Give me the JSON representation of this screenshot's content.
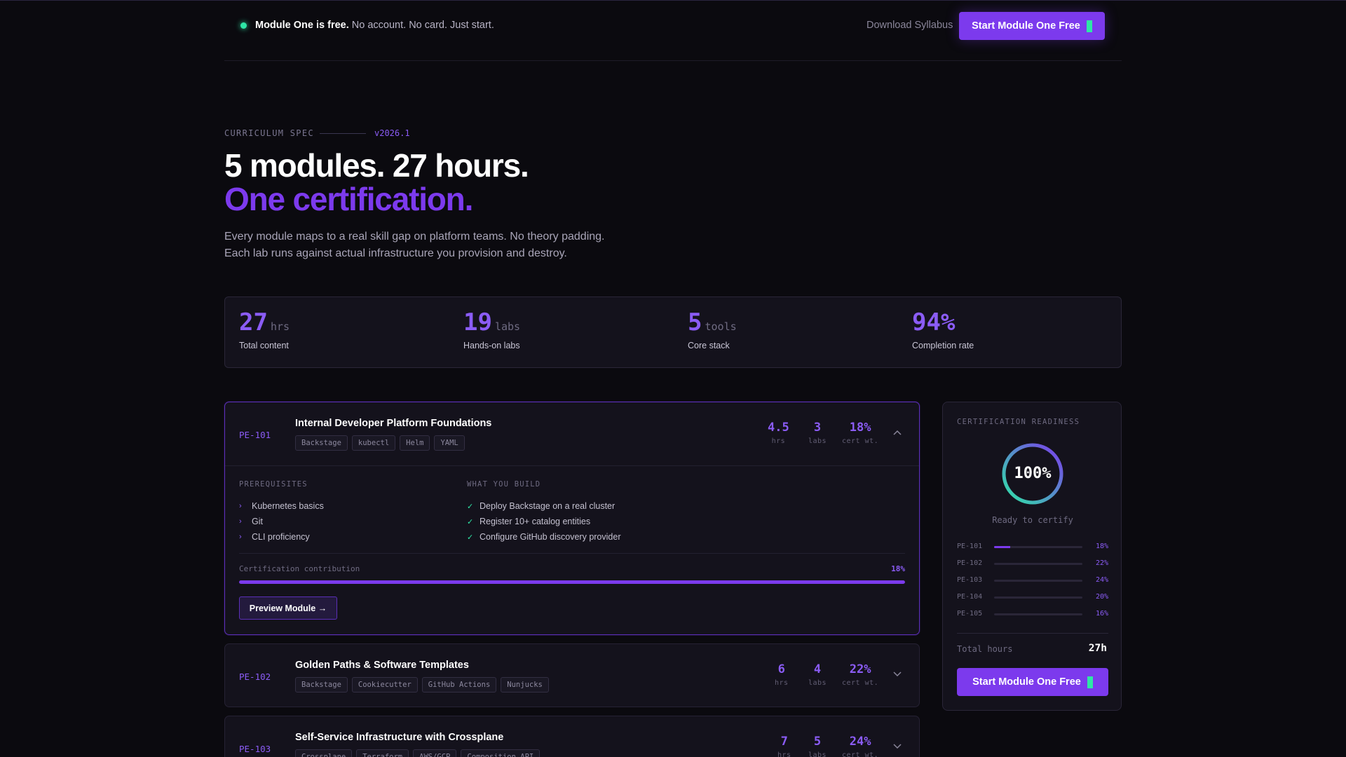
{
  "topbar": {
    "announce_bold": "Module One is free.",
    "announce_rest": "No account. No card. Just start.",
    "download_label": "Download Syllabus",
    "cta_label": "Start Module One Free"
  },
  "hero": {
    "eyebrow": "CURRICULUM SPEC",
    "version": "v2026.1",
    "title_line1": "5 modules. 27 hours.",
    "title_line2": "One certification.",
    "desc_line1": "Every module maps to a real skill gap on platform teams. No theory padding.",
    "desc_line2": "Each lab runs against actual infrastructure you provision and destroy."
  },
  "stats": [
    {
      "num": "27",
      "unit": "hrs",
      "label": "Total content"
    },
    {
      "num": "19",
      "unit": "labs",
      "label": "Hands-on labs"
    },
    {
      "num": "5",
      "unit": "tools",
      "label": "Core stack"
    },
    {
      "num": "94%",
      "unit": "",
      "label": "Completion rate"
    }
  ],
  "modules": [
    {
      "code": "PE-101",
      "title": "Internal Developer Platform Foundations",
      "tags": [
        "Backstage",
        "kubectl",
        "Helm",
        "YAML"
      ],
      "hrs": "4.5",
      "labs": "3",
      "cert": "18%",
      "hrs_unit": "hrs",
      "labs_unit": "labs",
      "cert_unit": "cert wt.",
      "expanded": true,
      "prereq_title": "PREREQUISITES",
      "prereqs": [
        "Kubernetes basics",
        "Git",
        "CLI proficiency"
      ],
      "build_title": "WHAT YOU BUILD",
      "builds": [
        "Deploy Backstage on a real cluster",
        "Register 10+ catalog entities",
        "Configure GitHub discovery provider"
      ],
      "contrib_label": "Certification contribution",
      "contrib_pct": "18%",
      "contrib_fill": 1.0,
      "preview_label": "Preview Module →"
    },
    {
      "code": "PE-102",
      "title": "Golden Paths & Software Templates",
      "tags": [
        "Backstage",
        "Cookiecutter",
        "GitHub Actions",
        "Nunjucks"
      ],
      "hrs": "6",
      "labs": "4",
      "cert": "22%",
      "hrs_unit": "hrs",
      "labs_unit": "labs",
      "cert_unit": "cert wt."
    },
    {
      "code": "PE-103",
      "title": "Self-Service Infrastructure with Crossplane",
      "tags": [
        "Crossplane",
        "Terraform",
        "AWS/GCP",
        "Composition API"
      ],
      "hrs": "7",
      "labs": "5",
      "cert": "24%",
      "hrs_unit": "hrs",
      "labs_unit": "labs",
      "cert_unit": "cert wt."
    }
  ],
  "readiness": {
    "title": "CERTIFICATION READINESS",
    "value": "100%",
    "progress": 1.0,
    "subtitle": "Ready to certify",
    "rows": [
      {
        "code": "PE-101",
        "pct": "18%",
        "fill": 0.18
      },
      {
        "code": "PE-102",
        "pct": "22%",
        "fill": 0
      },
      {
        "code": "PE-103",
        "pct": "24%",
        "fill": 0
      },
      {
        "code": "PE-104",
        "pct": "20%",
        "fill": 0
      },
      {
        "code": "PE-105",
        "pct": "16%",
        "fill": 0
      }
    ],
    "total_label": "Total hours",
    "total_value": "27h",
    "cta_label": "Start Module One Free"
  },
  "colors": {
    "accent": "#7c3aed",
    "accent_text": "#8b5cf6",
    "success": "#2ee6a6",
    "background": "#0b0a0f",
    "card": "#14121c"
  }
}
